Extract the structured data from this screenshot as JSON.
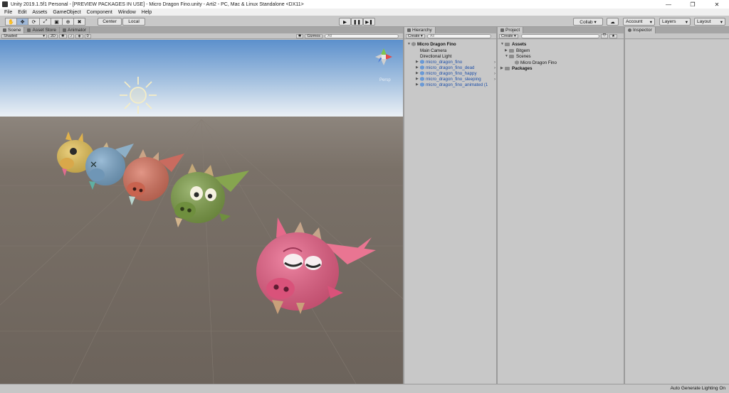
{
  "window": {
    "title": "Unity 2019.1.5f1 Personal - [PREVIEW PACKAGES IN USE] - Micro Dragon Fino.unity - Arti2 - PC, Mac & Linux Standalone <DX11>",
    "minimize": "—",
    "maximize": "❐",
    "close": "✕"
  },
  "menu": [
    "File",
    "Edit",
    "Assets",
    "GameObject",
    "Component",
    "Window",
    "Help"
  ],
  "toolbar": {
    "tools": [
      "✋",
      "✥",
      "⟳",
      "⤢",
      "▣",
      "⊕",
      "✖"
    ],
    "pivot": "Center",
    "space": "Local",
    "play": "▶",
    "pause": "❚❚",
    "step": "▶❚",
    "collab": "Collab ▾",
    "cloud": "☁",
    "account": "Account",
    "layers": "Layers",
    "layout": "Layout"
  },
  "scene_panel": {
    "tabs": [
      "Scene",
      "Asset Store",
      "Animator"
    ],
    "shading": "Shaded",
    "mode_2d": "2D",
    "light": "✺",
    "audio": "♪",
    "fx": "◈",
    "hidden": "0",
    "tools_icon": "✱",
    "gizmos": "Gizmos",
    "search_placeholder": "All",
    "persp": "Persp"
  },
  "hierarchy": {
    "tab": "Hierarchy",
    "create": "Create",
    "search_placeholder": "All",
    "root": "Micro Dragon Fino",
    "items": [
      {
        "label": "Main Camera",
        "blue": false,
        "expandable": false
      },
      {
        "label": "Directional Light",
        "blue": false,
        "expandable": false
      },
      {
        "label": "micro_dragon_fino",
        "blue": true,
        "expandable": true
      },
      {
        "label": "micro_dragon_fino_dead",
        "blue": true,
        "expandable": true
      },
      {
        "label": "micro_dragon_fino_happy",
        "blue": true,
        "expandable": true
      },
      {
        "label": "micro_dragon_fino_sleeping",
        "blue": true,
        "expandable": true
      },
      {
        "label": "micro_dragon_fino_animated (1",
        "blue": true,
        "expandable": true
      }
    ]
  },
  "project": {
    "tab": "Project",
    "create": "Create",
    "items": [
      {
        "label": "Assets",
        "level": 0,
        "bold": true,
        "kind": "folder"
      },
      {
        "label": "Bitgem",
        "level": 1,
        "bold": false,
        "kind": "folder"
      },
      {
        "label": "Scenes",
        "level": 1,
        "bold": false,
        "kind": "folder"
      },
      {
        "label": "Micro Dragon Fino",
        "level": 2,
        "bold": false,
        "kind": "scene"
      },
      {
        "label": "Packages",
        "level": 0,
        "bold": true,
        "kind": "folder"
      }
    ]
  },
  "inspector": {
    "tab": "Inspector"
  },
  "status": {
    "text": "Auto Generate Lighting On"
  },
  "colors": {
    "sky_top": "#6b9fd4",
    "sky_horizon": "#e6edf5",
    "ground": "#736a62",
    "dragon_yellow": "#e8c458",
    "dragon_blue": "#7aa6c9",
    "dragon_red": "#d8735e",
    "dragon_green": "#7fa048",
    "dragon_pink": "#ea5f86"
  }
}
